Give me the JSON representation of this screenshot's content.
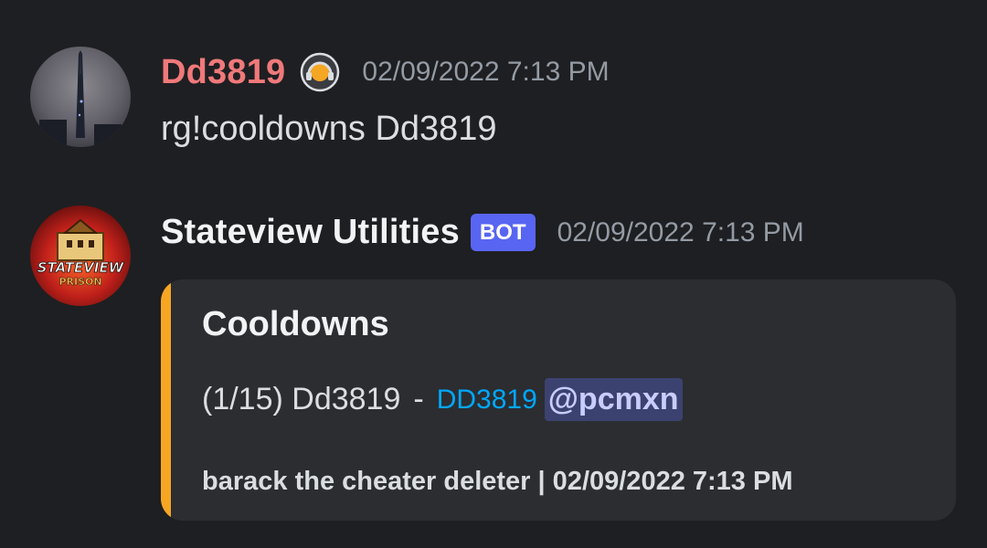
{
  "colors": {
    "background": "#1e1f22",
    "user1_name": "#f0797a",
    "user2_name": "#f2f3f5",
    "bot_tag": "#5865f2",
    "embed_accent": "#f5a623",
    "link": "#00a8fc",
    "mention_bg": "#3c4270"
  },
  "messages": [
    {
      "username": "Dd3819",
      "badge_icon": "headset-badge-icon",
      "timestamp": "02/09/2022 7:13 PM",
      "content": "rg!cooldowns Dd3819"
    },
    {
      "username": "Stateview Utilities",
      "bot_tag": "BOT",
      "timestamp": "02/09/2022 7:13 PM",
      "avatar_text_top": "STATEVIEW",
      "avatar_text_bottom": "PRISON",
      "embed": {
        "title": "Cooldowns",
        "desc_prefix": "(1/15) Dd3819",
        "desc_sep": "-",
        "desc_link": "DD3819",
        "desc_mention": "@pcmxn",
        "footer": "barack the cheater deleter | 02/09/2022 7:13 PM"
      }
    }
  ]
}
